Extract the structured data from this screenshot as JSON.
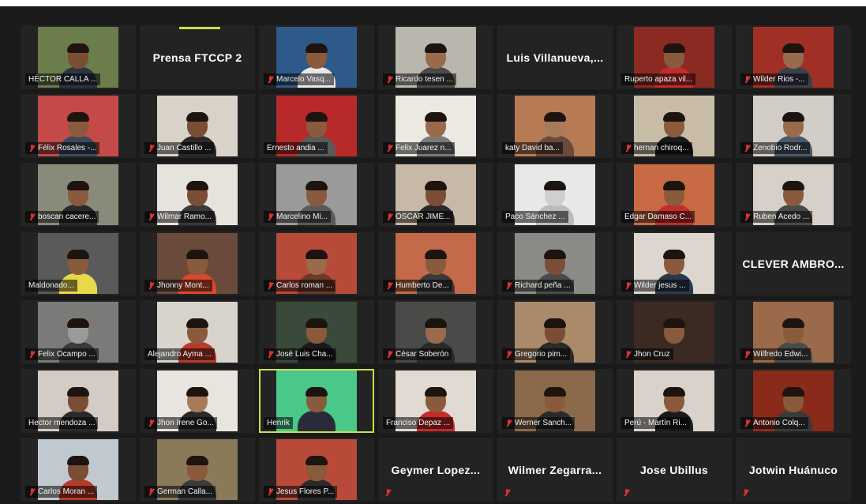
{
  "meeting": {
    "participants": [
      {
        "name": "HÉCTOR CALLA ...",
        "muted": false,
        "video": true,
        "bg": "#6b7d4a",
        "skin": "#7a4e35",
        "shirt": "#2c3342"
      },
      {
        "name": "Prensa FTCCP 2",
        "muted": false,
        "video": false,
        "speaking": true
      },
      {
        "name": "Marcelo Vasq...",
        "muted": true,
        "video": true,
        "bg": "#2d5a88",
        "skin": "#8a5a3c",
        "shirt": "#e8e8e8"
      },
      {
        "name": "Ricardo tesen ...",
        "muted": true,
        "video": true,
        "bg": "#b8b6ad",
        "skin": "#9a6a4c",
        "shirt": "#4a4a4a"
      },
      {
        "name": "Luis  Villanueva,...",
        "muted": false,
        "video": false
      },
      {
        "name": "Ruperto apaza vil...",
        "muted": false,
        "video": true,
        "bg": "#8a2a22",
        "skin": "#8a5a3c",
        "shirt": "#c62a2a"
      },
      {
        "name": "Wilder Rios -...",
        "muted": true,
        "video": true,
        "bg": "#a03026",
        "skin": "#9a6a4c",
        "shirt": "#3a3f4a"
      },
      {
        "name": "Félix Rosales -...",
        "muted": true,
        "video": true,
        "bg": "#c44a4a",
        "skin": "#8a5a3c",
        "shirt": "#3a4a5a"
      },
      {
        "name": "Juan Castillo ...",
        "muted": true,
        "video": true,
        "bg": "#d8d2c8",
        "skin": "#7a4e35",
        "shirt": "#2a2a2a"
      },
      {
        "name": "Ernesto andia ...",
        "muted": false,
        "video": true,
        "bg": "#b82a2a",
        "skin": "#8a5a3c",
        "shirt": "#5a5a5a"
      },
      {
        "name": "Felix Juarez n...",
        "muted": true,
        "video": true,
        "bg": "#ece8e2",
        "skin": "#9a6a4c",
        "shirt": "#7a7a7a"
      },
      {
        "name": "katy David  ba...",
        "muted": false,
        "video": true,
        "bg": "#b67a55",
        "skin": "#a87a5a",
        "shirt": "#6a4a3a"
      },
      {
        "name": "hernan chiroq...",
        "muted": true,
        "video": true,
        "bg": "#c8bca6",
        "skin": "#8a5a3c",
        "shirt": "#1a1a1a"
      },
      {
        "name": "Zenobio Rodr...",
        "muted": true,
        "video": true,
        "bg": "#d2cdc6",
        "skin": "#9a6a4c",
        "shirt": "#4a5a6a"
      },
      {
        "name": "boscan cacere...",
        "muted": true,
        "video": true,
        "bg": "#8a8a7a",
        "skin": "#8a5a3c",
        "shirt": "#2a2a2a"
      },
      {
        "name": "Wilmar Ramo...",
        "muted": true,
        "video": true,
        "bg": "#e6e2dc",
        "skin": "#7a4e35",
        "shirt": "#3a3a3a"
      },
      {
        "name": "Marcelino Mi...",
        "muted": true,
        "video": true,
        "bg": "#9a9a98",
        "skin": "#8a5a3c",
        "shirt": "#5a5a5a"
      },
      {
        "name": "OSCAR JIME...",
        "muted": true,
        "video": true,
        "bg": "#c8b8a8",
        "skin": "#7a4e35",
        "shirt": "#2a2a2a"
      },
      {
        "name": "Paco Sánchez ...",
        "muted": false,
        "video": true,
        "bg": "#e8e8e8",
        "skin": "#cfcfcf",
        "shirt": "#bbbbbb"
      },
      {
        "name": "Edgar Damaso C...",
        "muted": false,
        "video": true,
        "bg": "#c86a44",
        "skin": "#8a5a3c",
        "shirt": "#c62a2a"
      },
      {
        "name": "Ruben Acedo ...",
        "muted": true,
        "video": true,
        "bg": "#d6d0c8",
        "skin": "#8a5a3c",
        "shirt": "#4a4a4a"
      },
      {
        "name": "Maldonado...",
        "muted": false,
        "video": true,
        "bg": "#5a5a5a",
        "skin": "#8a5a3c",
        "shirt": "#e8d84a"
      },
      {
        "name": "Jhonny Mont...",
        "muted": true,
        "video": true,
        "bg": "#6a4a3a",
        "skin": "#8a5a3c",
        "shirt": "#d84a2a"
      },
      {
        "name": "Carlos roman ...",
        "muted": true,
        "video": true,
        "bg": "#b84a3a",
        "skin": "#9a6a4c",
        "shirt": "#6a3a2a"
      },
      {
        "name": "Humberto De...",
        "muted": true,
        "video": true,
        "bg": "#c26a4a",
        "skin": "#8a5a3c",
        "shirt": "#3a3a3a"
      },
      {
        "name": "Richard peña ...",
        "muted": true,
        "video": true,
        "bg": "#8a8a86",
        "skin": "#7a4e35",
        "shirt": "#4a4a4a"
      },
      {
        "name": "Wilder jesus ...",
        "muted": true,
        "video": true,
        "bg": "#dcd6ce",
        "skin": "#8a5a3c",
        "shirt": "#2a3a4a"
      },
      {
        "name": "CLEVER AMBRO...",
        "muted": false,
        "video": false
      },
      {
        "name": "Felix Ocampo ...",
        "muted": true,
        "video": true,
        "bg": "#7a7a78",
        "skin": "#9a9a9a",
        "shirt": "#3a3a3a"
      },
      {
        "name": "Alejandro Ayma ...",
        "muted": false,
        "video": true,
        "bg": "#d8d4cc",
        "skin": "#8a5a3c",
        "shirt": "#b83a2a"
      },
      {
        "name": "José Luis Cha...",
        "muted": true,
        "video": true,
        "bg": "#3a4a3a",
        "skin": "#8a5a3c",
        "shirt": "#1a1a1a"
      },
      {
        "name": "César Soberón",
        "muted": true,
        "video": true,
        "bg": "#4a4a48",
        "skin": "#9a6a4c",
        "shirt": "#2a2a2a"
      },
      {
        "name": "Gregorio pim...",
        "muted": true,
        "video": true,
        "bg": "#aa8a6a",
        "skin": "#7a4e35",
        "shirt": "#2a2a2a"
      },
      {
        "name": "Jhon Cruz",
        "muted": true,
        "video": true,
        "bg": "#3a2a22",
        "skin": "#8a5a3c",
        "shirt": "#3a2a22"
      },
      {
        "name": "Wilfredo Edwi...",
        "muted": true,
        "video": true,
        "bg": "#9a6a4a",
        "skin": "#8a5a3c",
        "shirt": "#4a4a4a"
      },
      {
        "name": "Hector mendoza ...",
        "muted": false,
        "video": true,
        "bg": "#d2ccc4",
        "skin": "#7a4e35",
        "shirt": "#2a2a2a"
      },
      {
        "name": "Jhon Irene Go...",
        "muted": true,
        "video": true,
        "bg": "#e8e4de",
        "skin": "#a87a5a",
        "shirt": "#2a2a2a"
      },
      {
        "name": "Henrik",
        "muted": false,
        "video": true,
        "active": true,
        "bg": "#4ac88a",
        "skin": "#8a5a3c",
        "shirt": "#2a2a3a"
      },
      {
        "name": "Franciso Depaz ...",
        "muted": false,
        "video": true,
        "bg": "#e0dad2",
        "skin": "#8a5a3c",
        "shirt": "#c62a2a"
      },
      {
        "name": "Werner Sanch...",
        "muted": true,
        "video": true,
        "bg": "#8a6a4a",
        "skin": "#8a5a3c",
        "shirt": "#2a2a2a"
      },
      {
        "name": "Perú - Martín Ri...",
        "muted": false,
        "video": true,
        "bg": "#d8d2ca",
        "skin": "#8a5a3c",
        "shirt": "#1a1a1a"
      },
      {
        "name": "Antonio Colq...",
        "muted": true,
        "video": true,
        "bg": "#8a2a1a",
        "skin": "#8a5a3c",
        "shirt": "#3a3a3a"
      },
      {
        "name": "Carlos Moran ...",
        "muted": true,
        "video": true,
        "bg": "#c0c8d0",
        "skin": "#7a4e35",
        "shirt": "#b83a2a"
      },
      {
        "name": "German Calla...",
        "muted": true,
        "video": true,
        "bg": "#8a7a5a",
        "skin": "#8a5a3c",
        "shirt": "#3a3a3a"
      },
      {
        "name": "Jesus Flores P...",
        "muted": true,
        "video": true,
        "bg": "#b84a3a",
        "skin": "#8a5a3c",
        "shirt": "#2a2a2a"
      },
      {
        "name": "Geymer  Lopez...",
        "muted": true,
        "video": false
      },
      {
        "name": "Wilmer  Zegarra...",
        "muted": true,
        "video": false
      },
      {
        "name": "Jose Ubillus",
        "muted": true,
        "video": false
      },
      {
        "name": "Jotwin Huánuco",
        "muted": true,
        "video": false
      }
    ]
  }
}
